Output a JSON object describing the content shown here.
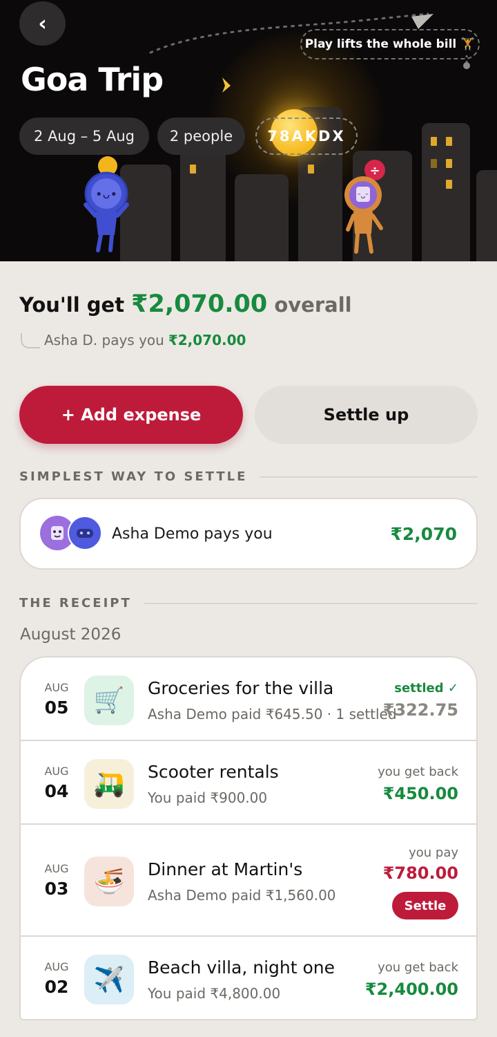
{
  "header": {
    "back_icon": "chevron-left-icon",
    "title": "Goa Trip",
    "dates": "2 Aug – 5 Aug",
    "people": "2 people",
    "code": "78AKDX",
    "play_note": "Play lifts the whole bill 🏋",
    "colors": {
      "bg": "#0B0909",
      "window": "#E0A92E",
      "chip": "#2E2C2C"
    }
  },
  "summary": {
    "prefix": "You'll get",
    "amount": "₹2,070.00",
    "suffix": "overall",
    "detail_prefix": "Asha D. pays you",
    "detail_amount": "₹2,070.00"
  },
  "actions": {
    "add_label": "+ Add expense",
    "settle_label": "Settle up"
  },
  "settle_section": {
    "heading": "SIMPLEST WAY TO SETTLE",
    "text": "Asha Demo pays you",
    "amount": "₹2,070"
  },
  "receipt": {
    "heading": "THE RECEIPT",
    "month": "August 2026",
    "items": [
      {
        "mon": "AUG",
        "day": "05",
        "icon": "shopping-cart-icon",
        "glyph": "🛒",
        "title": "Groceries for the villa",
        "sub": "Asha Demo paid ₹645.50 · 1 settled",
        "status": "settled ✓",
        "amount": "₹322.75"
      },
      {
        "mon": "AUG",
        "day": "04",
        "icon": "auto-rickshaw-icon",
        "glyph": "🛺",
        "title": "Scooter rentals",
        "sub": "You paid ₹900.00",
        "status": "you get back",
        "amount": "₹450.00"
      },
      {
        "mon": "AUG",
        "day": "03",
        "icon": "noodle-bowl-icon",
        "glyph": "🍜",
        "title": "Dinner at Martin's",
        "sub": "Asha Demo paid ₹1,560.00",
        "status": "you pay",
        "amount": "₹780.00",
        "action": "Settle"
      },
      {
        "mon": "AUG",
        "day": "02",
        "icon": "airplane-icon",
        "glyph": "✈️",
        "title": "Beach villa, night one",
        "sub": "You paid ₹4,800.00",
        "status": "you get back",
        "amount": "₹2,400.00"
      }
    ]
  },
  "colors": {
    "positive": "#178A3E",
    "negative": "#BE1B3B",
    "muted": "#6C6863",
    "page_bg": "#ECE9E4"
  }
}
